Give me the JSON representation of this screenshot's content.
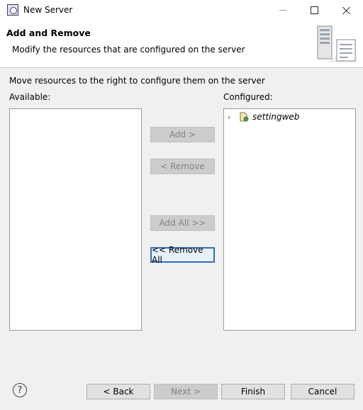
{
  "window": {
    "title": "New Server",
    "minimize_icon": "minimize-icon",
    "maximize_icon": "maximize-icon",
    "close_icon": "close-icon"
  },
  "header": {
    "title": "Add and Remove",
    "description": "Modify the resources that are configured on the server",
    "banner_icon": "server-wizard-banner-icon"
  },
  "content": {
    "description": "Move resources to the right to configure them on the server",
    "available_label": "Available:",
    "configured_label": "Configured:",
    "available_items": [],
    "configured_items": [
      {
        "label": "settingweb",
        "icon": "web-project-icon",
        "expandable": true
      }
    ]
  },
  "buttons": {
    "add": {
      "label": "Add >",
      "enabled": false
    },
    "remove": {
      "label": "< Remove",
      "enabled": false
    },
    "add_all": {
      "label": "Add All >>",
      "enabled": false
    },
    "remove_all": {
      "label": "<< Remove All",
      "enabled": true
    }
  },
  "footer": {
    "help_glyph": "?",
    "back": {
      "label": "< Back",
      "enabled": true
    },
    "next": {
      "label": "Next >",
      "enabled": false
    },
    "finish": {
      "label": "Finish",
      "enabled": true
    },
    "cancel": {
      "label": "Cancel",
      "enabled": true
    }
  },
  "colors": {
    "dialog_background": "#f0f0f0",
    "header_background": "#ffffff",
    "default_button_border": "#2f6fbf"
  }
}
